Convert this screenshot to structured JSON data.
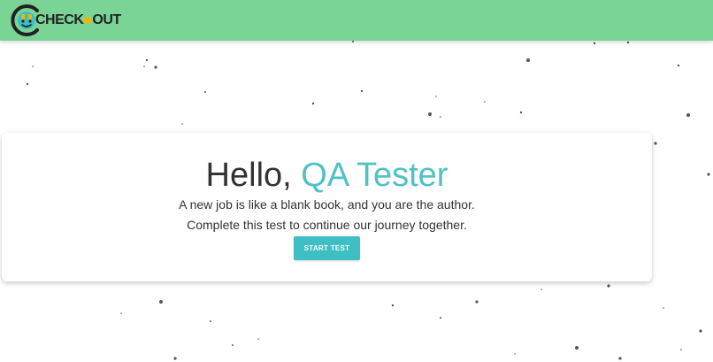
{
  "header": {
    "logo": {
      "text_before": "CHECK",
      "text_after": "OUT"
    },
    "background_color": "#79d496"
  },
  "card": {
    "greeting": "Hello,",
    "name": "QA Tester",
    "line1": "A new job is like a blank book, and you are the author.",
    "line2": "Complete this test to continue our journey together.",
    "button_label": "START TEST"
  },
  "colors": {
    "accent": "#4fc1c7",
    "button": "#3dbfc4",
    "text": "#333333"
  }
}
